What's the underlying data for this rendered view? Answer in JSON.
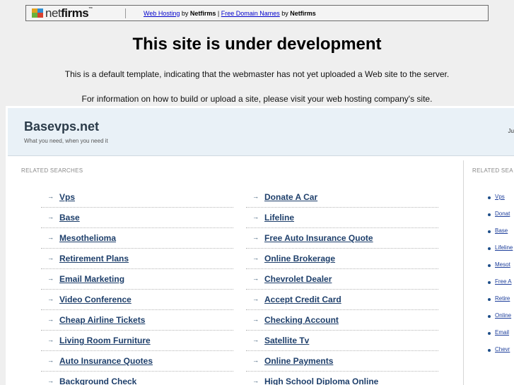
{
  "topbar": {
    "logo_text_a": "net",
    "logo_text_b": "firms",
    "logo_tm": "™",
    "link1": "Web Hosting",
    "by1": " by ",
    "brand1": "Netfirms",
    "pipe": " | ",
    "link2": "Free Domain Names",
    "by2": " by ",
    "brand2": "Netfirms"
  },
  "headline": "This site is under development",
  "note1": "This is a default template, indicating that the webmaster has not yet uploaded a Web site to the server.",
  "note2": "For information on how to build or upload a site, please visit your web hosting company's site.",
  "parked": {
    "site_name": "Basevps.net",
    "tagline": "What you need, when you need it",
    "head_right": "Ju",
    "related_label": "RELATED SEARCHES",
    "related_label_side": "RELATED SEA",
    "col1": [
      "Vps",
      "Base",
      "Mesothelioma",
      "Retirement Plans",
      "Email Marketing",
      "Video Conference",
      "Cheap Airline Tickets",
      "Living Room Furniture",
      "Auto Insurance Quotes",
      "Background Check"
    ],
    "col2": [
      "Donate A Car",
      "Lifeline",
      "Free Auto Insurance Quote",
      "Online Brokerage",
      "Chevrolet Dealer",
      "Accept Credit Card",
      "Checking Account",
      "Satellite Tv",
      "Online Payments",
      "High School Diploma Online"
    ],
    "side": [
      "Vps",
      "Donat",
      "Base",
      "Lifeline",
      "Mesot",
      "Free A",
      "Retire",
      "Online",
      "Email",
      "Chevr"
    ]
  },
  "icons": {
    "arrow": "→"
  }
}
